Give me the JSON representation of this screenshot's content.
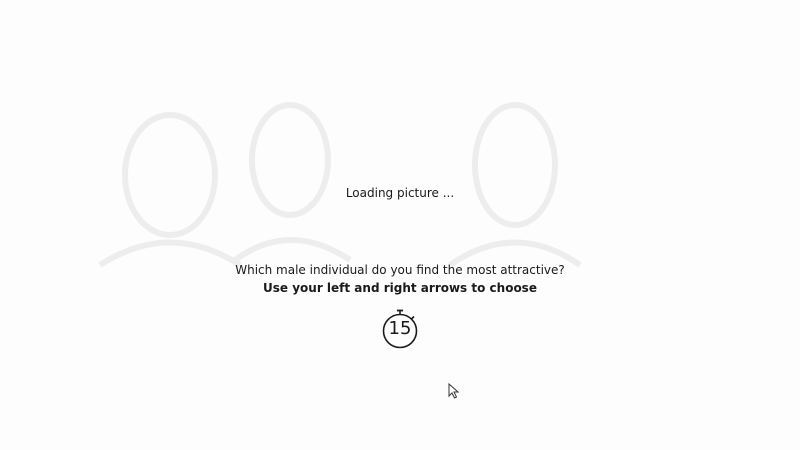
{
  "loading": {
    "text": "Loading picture ..."
  },
  "prompt": {
    "question": "Which male individual do you find the most attractive?",
    "instruction": "Use your left and right arrows to choose"
  },
  "timer": {
    "seconds_remaining": "15"
  },
  "icons": {
    "stopwatch": "stopwatch-icon",
    "cursor": "mouse-cursor-icon"
  },
  "colors": {
    "background": "#fdfdfd",
    "text": "#1a1a1a"
  }
}
